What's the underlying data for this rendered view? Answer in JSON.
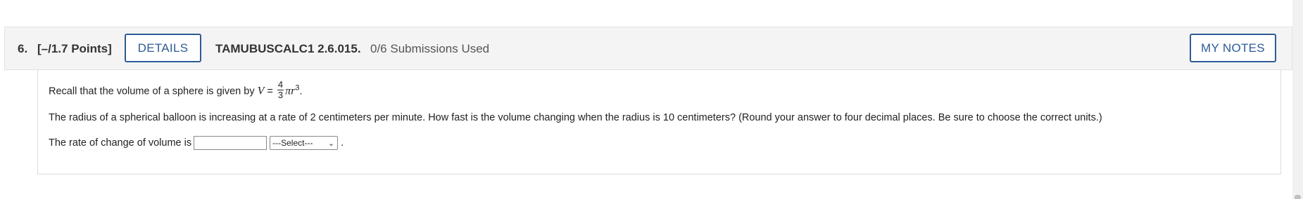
{
  "question": {
    "number": "6.",
    "points": "[–/1.7 Points]",
    "details_label": "DETAILS",
    "problem_id": "TAMUBUSCALC1 2.6.015.",
    "submissions": "0/6 Submissions Used",
    "my_notes_label": "MY NOTES"
  },
  "body": {
    "recall_text": "Recall that the volume of a sphere is given by ",
    "formula_var": "V",
    "formula_eq": " = ",
    "frac_num": "4",
    "frac_den": "3",
    "formula_pi_r": "πr",
    "formula_exp": "3",
    "formula_end": ".",
    "problem_text": "The radius of a spherical balloon is increasing at a rate of 2 centimeters per minute. How fast is the volume changing when the radius is 10 centimeters? (Round your answer to four decimal places. Be sure to choose the correct units.)",
    "answer_prefix": "The rate of change of volume is",
    "answer_value": "",
    "units_selected": "---Select---",
    "answer_suffix": "."
  }
}
